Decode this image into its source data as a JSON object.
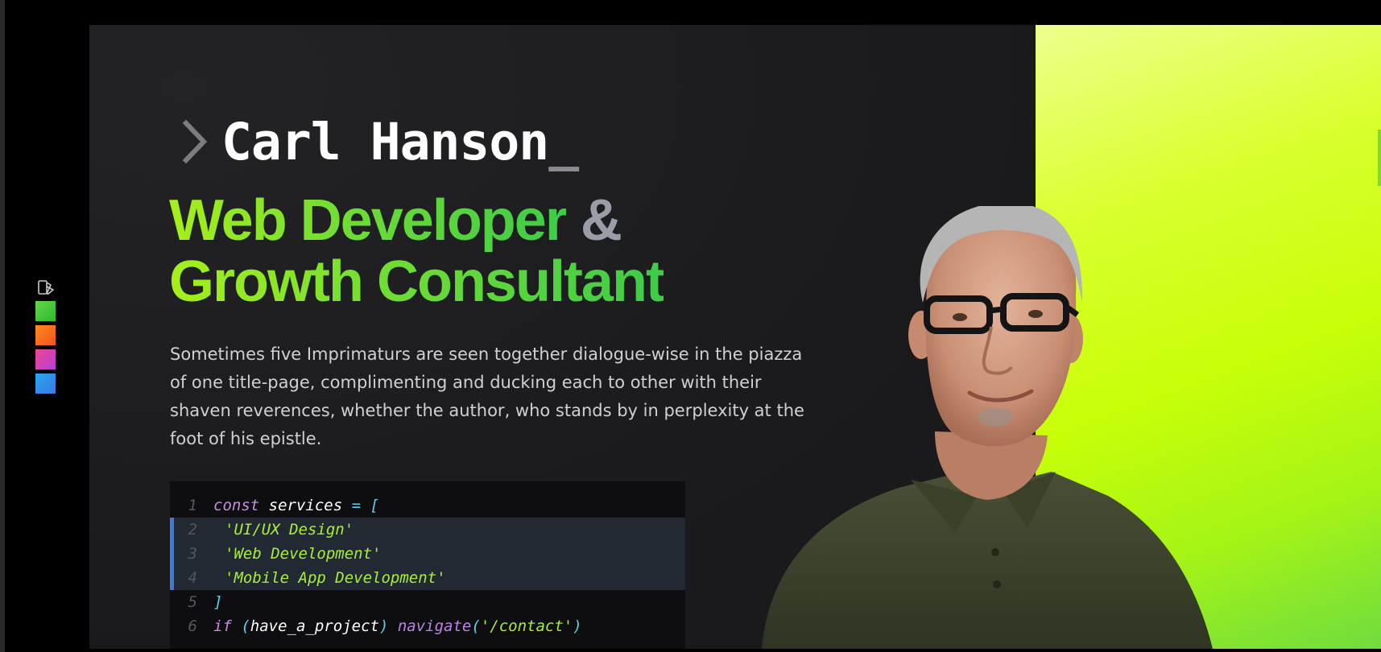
{
  "hero": {
    "name": "Carl Hanson",
    "cursor": "_",
    "headline_part1": "Web Developer",
    "headline_amp": "&",
    "headline_part2": "Growth Consultant",
    "description": "Sometimes five Imprimaturs are seen together dialogue-wise in the piazza of one title-page, complimenting and ducking each to other with their shaven reverences, whether the author, who stands by in perplexity at the foot of his epistle."
  },
  "theme_switcher": {
    "icon": "palette-icon",
    "swatches": [
      {
        "name": "green",
        "color": "#4cc93a"
      },
      {
        "name": "orange",
        "color": "#f56d1f"
      },
      {
        "name": "pink",
        "color": "#d746b4"
      },
      {
        "name": "blue",
        "color": "#3090ea"
      }
    ]
  },
  "code": {
    "l1": {
      "num": "1",
      "kw": "const",
      "ident": "services",
      "op": "= ["
    },
    "l2": {
      "num": "2",
      "str": "'UI/UX Design'"
    },
    "l3": {
      "num": "3",
      "str": "'Web Development'"
    },
    "l4": {
      "num": "4",
      "str": "'Mobile App Development'"
    },
    "l5": {
      "num": "5",
      "op": "]"
    },
    "l6": {
      "num": "6",
      "kw": "if",
      "paren_open": "(",
      "ident": "have_a_project",
      "paren_close": ")",
      "fn": "navigate",
      "arg_open": "(",
      "str": "'/contact'",
      "arg_close": ")"
    }
  },
  "colors": {
    "accent_green": "#a6ef1c",
    "highlight_bar": "#3d7bd8",
    "background": "#1b1b1d"
  }
}
